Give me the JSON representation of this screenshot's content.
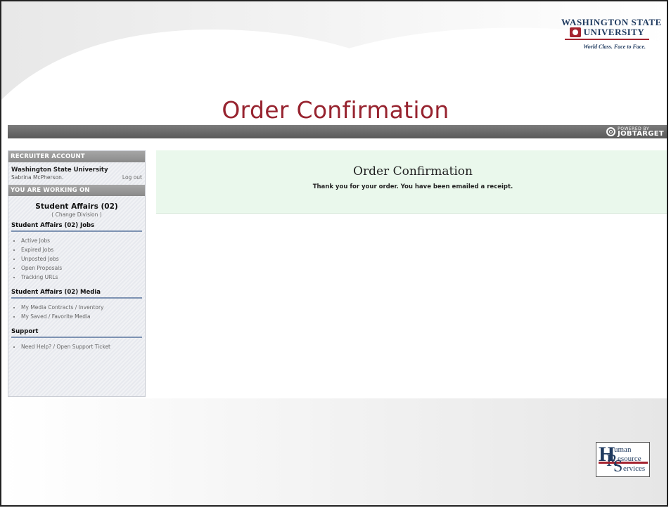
{
  "slide": {
    "title": "Order Confirmation"
  },
  "wsu_logo": {
    "line1": "WASHINGTON STATE",
    "line2": "UNIVERSITY",
    "tagline": "World Class. Face to Face."
  },
  "topbar": {
    "powered_by_small": "POWERED BY",
    "powered_by_big": "JOBTARGET"
  },
  "sidebar": {
    "recruiter_header": "RECRUITER ACCOUNT",
    "organization": "Washington State University",
    "user": "Sabrina McPherson.",
    "logout": "Log out",
    "working_on_header": "YOU ARE WORKING ON",
    "division": "Student Affairs (02)",
    "change_division": "( Change Division )",
    "jobs_section": "Student Affairs (02) Jobs",
    "jobs_items": [
      "Active Jobs",
      "Expired Jobs",
      "Unposted Jobs",
      "Open Proposals",
      "Tracking URLs"
    ],
    "media_section": "Student Affairs (02) Media",
    "media_items": [
      "My Media Contracts / Inventory",
      "My Saved / Favorite Media"
    ],
    "support_section": "Support",
    "support_items": [
      "Need Help? / Open Support Ticket"
    ]
  },
  "main": {
    "heading": "Order Confirmation",
    "message": "Thank you for your order. You have been emailed a receipt."
  },
  "hr_logo": {
    "h": "H",
    "uman": "uman",
    "r": "R",
    "esource": "esource",
    "s": "S",
    "ervices": "ervices"
  },
  "colors": {
    "title": "#97232f",
    "crimson": "#a4232f",
    "navy": "#1f3a5f",
    "confirm_bg": "#eaf8ec"
  }
}
